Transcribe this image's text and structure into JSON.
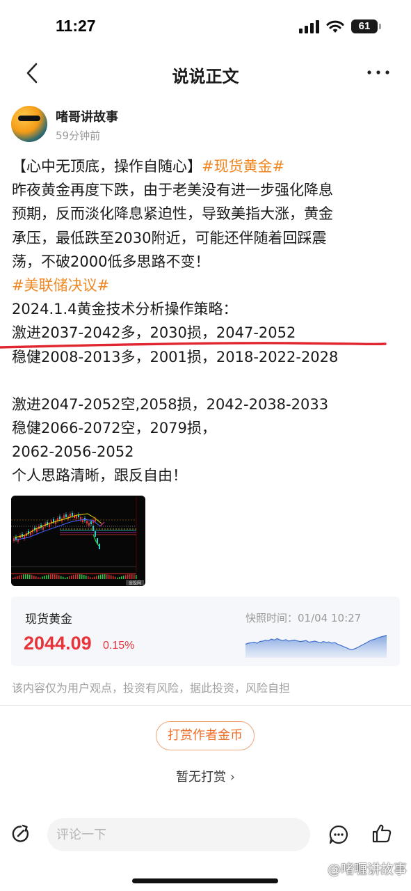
{
  "status_bar": {
    "time": "11:27",
    "battery": "61"
  },
  "nav": {
    "title": "说说正文"
  },
  "author": {
    "name": "啫哥讲故事",
    "time": "59分钟前"
  },
  "post": {
    "lines": [
      [
        {
          "t": "【心中无顶底，操作自随心】",
          "tag": false
        },
        {
          "t": "#现货黄金#",
          "tag": true
        }
      ],
      [
        {
          "t": "昨夜黄金再度下跌，由于老美没有进一步强化降息",
          "tag": false
        }
      ],
      [
        {
          "t": "预期，反而淡化降息紧迫性，导致美指大涨，黄金",
          "tag": false
        }
      ],
      [
        {
          "t": "承压，最低跌至2030附近，可能还伴随着回踩震",
          "tag": false
        }
      ],
      [
        {
          "t": "荡，不破2000低多思路不变！",
          "tag": false
        }
      ],
      [
        {
          "t": "#美联储决议#",
          "tag": true
        }
      ],
      [
        {
          "t": "2024.1.4黄金技术分析操作策略：",
          "tag": false
        }
      ],
      [
        {
          "t": "激进2037-2042多，2030损，2047-2052",
          "tag": false
        }
      ],
      [
        {
          "t": "稳健2008-2013多，2001损，2018-2022-2028",
          "tag": false
        }
      ],
      [
        {
          "t": "",
          "tag": false
        }
      ],
      [
        {
          "t": "激进2047-2052空,2058损，2042-2038-2033",
          "tag": false
        }
      ],
      [
        {
          "t": "稳健2066-2072空，2079损，",
          "tag": false
        }
      ],
      [
        {
          "t": "2062-2056-2052",
          "tag": false
        }
      ],
      [
        {
          "t": "个人思路清晰，跟反自由！",
          "tag": false
        }
      ]
    ]
  },
  "image": {
    "label": "金投网"
  },
  "quote": {
    "name": "现货黄金",
    "price": "2044.09",
    "change": "0.15%",
    "snapshot": "快照时间：01/04 10:27",
    "spark": [
      0.55,
      0.5,
      0.48,
      0.45,
      0.5,
      0.42,
      0.4,
      0.36,
      0.38,
      0.3,
      0.35,
      0.28,
      0.34,
      0.38,
      0.33,
      0.4,
      0.37,
      0.35,
      0.39,
      0.42,
      0.4,
      0.37,
      0.45,
      0.43,
      0.4,
      0.44,
      0.48,
      0.42,
      0.46,
      0.44,
      0.5,
      0.47,
      0.55,
      0.6,
      0.66,
      0.72,
      0.78,
      0.82,
      0.76,
      0.7,
      0.62,
      0.55,
      0.48,
      0.4,
      0.34,
      0.3,
      0.24,
      0.2,
      0.16,
      0.12
    ]
  },
  "disclaimer": "该内容仅为用户观点，投资有风险，据此投资，风险自担",
  "reward": {
    "button": "打赏作者金币",
    "none": "暂无打赏"
  },
  "comment": {
    "placeholder": "评论一下"
  },
  "watermark": "@啫喱讲故事",
  "colors": {
    "tag": "#f0861f",
    "price_up": "#e8333a",
    "reward": "#ee6f2a",
    "underline": "#e0262f"
  }
}
